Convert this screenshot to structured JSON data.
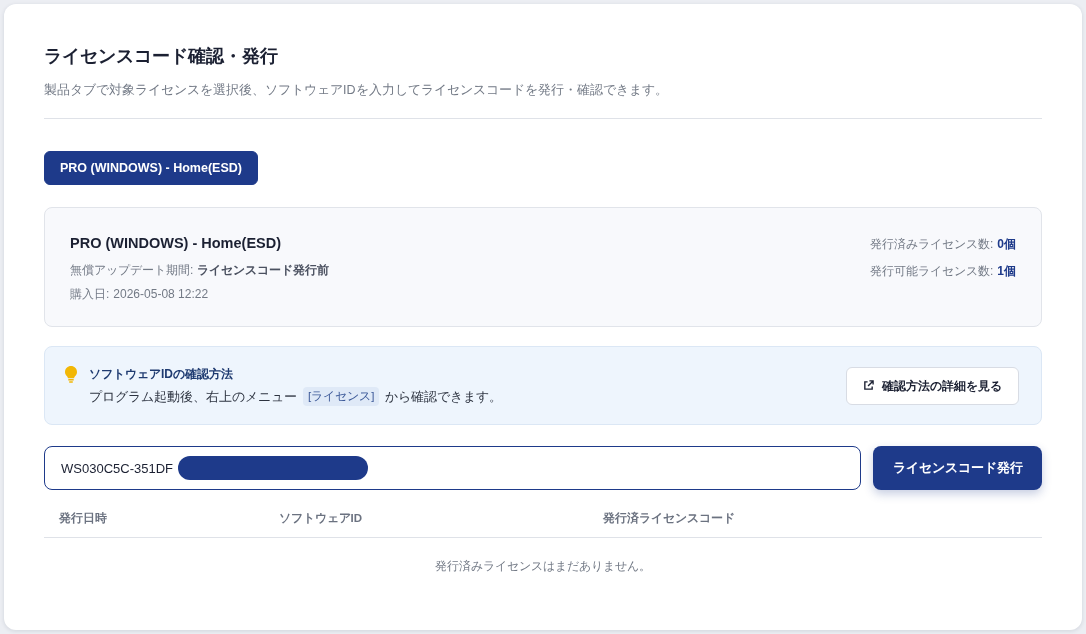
{
  "page": {
    "title": "ライセンスコード確認・発行",
    "description": "製品タブで対象ライセンスを選択後、ソフトウェアIDを入力してライセンスコードを発行・確認できます。"
  },
  "product_tabs": [
    {
      "label": "PRO (WINDOWS) - Home(ESD)",
      "selected": true
    }
  ],
  "license_card": {
    "product_name": "PRO (WINDOWS) - Home(ESD)",
    "details": [
      {
        "label": "無償アップデート期間:",
        "value": "ライセンスコード発行前",
        "emphasis": true
      },
      {
        "label": "購入日:",
        "value": "2026-05-08 12:22",
        "emphasis": false
      }
    ],
    "counts": [
      {
        "label": "発行済みライセンス数:",
        "value": "0個"
      },
      {
        "label": "発行可能ライセンス数:",
        "value": "1個"
      }
    ]
  },
  "tip": {
    "title": "ソフトウェアIDの確認方法",
    "text_before": "プログラム起動後、右上のメニュー",
    "menu_tag": "[ライセンス]",
    "text_after": "から確認できます。",
    "button": "確認方法の詳細を見る"
  },
  "software_id_field": {
    "value": "WS030C5C-351DF",
    "redacted": true
  },
  "issue_button": "ライセンスコード発行",
  "table": {
    "columns": [
      "発行日時",
      "ソフトウェアID",
      "発行済ライセンスコード"
    ],
    "empty_message": "発行済みライセンスはまだありません。"
  }
}
